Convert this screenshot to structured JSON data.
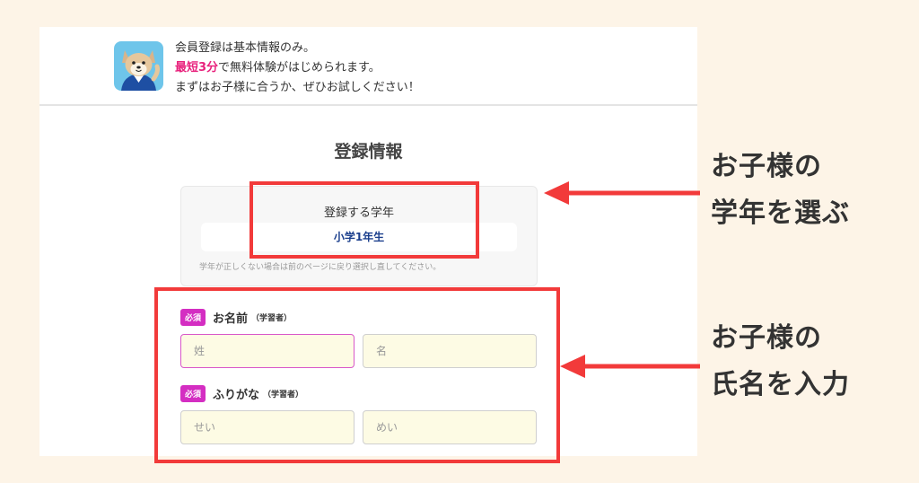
{
  "banner": {
    "line1": "会員登録は基本情報のみ。",
    "line2_highlight": "最短3分",
    "line2_rest": "で無料体験がはじめられます。",
    "line3": "まずはお子様に合うか、ぜひお試しください！"
  },
  "form": {
    "title": "登録情報",
    "grade": {
      "label": "登録する学年",
      "value": "小学1年生",
      "note": "学年が正しくない場合は前のページに戻り選択し直してください。"
    },
    "name": {
      "required_badge": "必須",
      "label": "お名前",
      "sublabel": "（学習者）",
      "last_placeholder": "姓",
      "first_placeholder": "名"
    },
    "kana": {
      "required_badge": "必須",
      "label": "ふりがな",
      "sublabel": "（学習者）",
      "last_placeholder": "せい",
      "first_placeholder": "めい"
    }
  },
  "annotations": {
    "grade_line1": "お子様の",
    "grade_line2": "学年を選ぶ",
    "name_line1": "お子様の",
    "name_line2": "氏名を入力",
    "accent": "#f23a3a"
  }
}
